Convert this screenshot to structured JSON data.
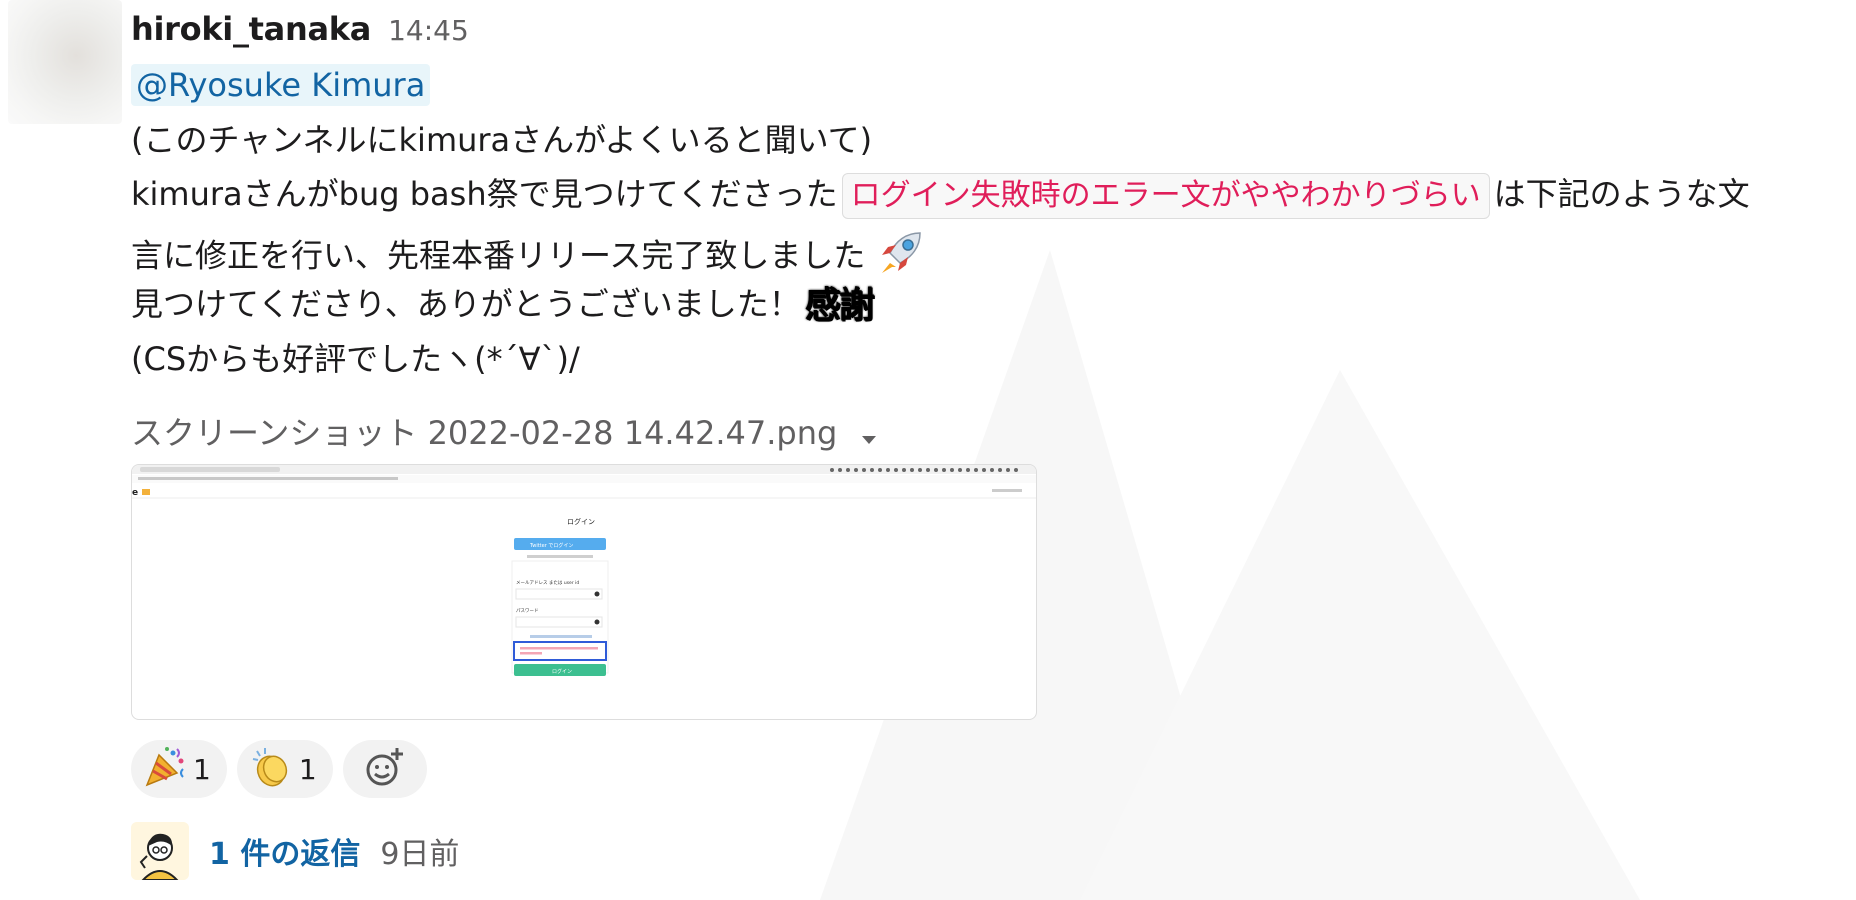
{
  "message": {
    "author": "hiroki_tanaka",
    "timestamp": "14:45",
    "mention": "@Ryosuke Kimura",
    "line1": "(このチャンネルにkimuraさんがよくいると聞いて)",
    "line2_before": "kimuraさんがbug bash祭で見つけてくださった",
    "line2_code": "ログイン失敗時のエラー文がややわかりづらい",
    "line2_after": "は下記のような文",
    "line3": "言に修正を行い、先程本番リリース完了致しました",
    "line3_emoji": "rocket-icon",
    "line4": "見つけてくださり、ありがとうございました！",
    "line4_emoji_text": "感謝",
    "line5": "(CSからも好評でしたヽ(*´∀`)/"
  },
  "attachment": {
    "filename": "スクリーンショット 2022-02-28 14.42.47.png",
    "preview": {
      "page_title": "ログイン",
      "twitter_button": "Twitter でログイン",
      "email_label": "メールアドレス または user id",
      "password_label": "パスワード",
      "login_button": "ログイン"
    }
  },
  "reactions": [
    {
      "icon": "party-popper-icon",
      "count": "1"
    },
    {
      "icon": "clapping-hands-icon",
      "count": "1"
    }
  ],
  "thread": {
    "reply_count": "1 件の返信",
    "reply_time": "9日前"
  },
  "colors": {
    "link": "#1264a3",
    "code_text": "#e01e5a",
    "mention_bg": "#e8f5fa",
    "secondary_text": "#616061",
    "reaction_bg": "#f2f2f2"
  }
}
